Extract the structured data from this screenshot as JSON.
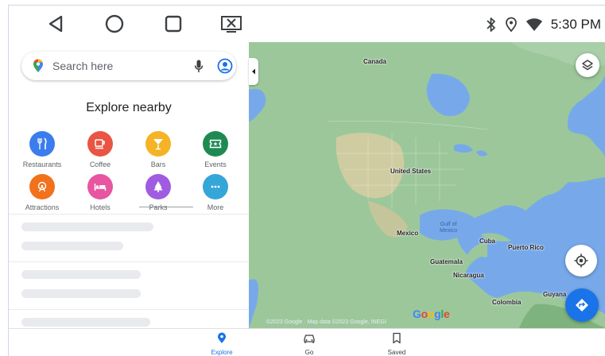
{
  "system_bar": {
    "time": "5:30 PM"
  },
  "search": {
    "placeholder": "Search here"
  },
  "explore": {
    "title": "Explore nearby",
    "categories": [
      {
        "label": "Restaurants",
        "icon": "fork-knife-icon",
        "color": "#3b7ded"
      },
      {
        "label": "Coffee",
        "icon": "coffee-cup-icon",
        "color": "#ea5443"
      },
      {
        "label": "Bars",
        "icon": "cocktail-glass-icon",
        "color": "#f5b325"
      },
      {
        "label": "Events",
        "icon": "ticket-icon",
        "color": "#1e8a52"
      },
      {
        "label": "Attractions",
        "icon": "ferris-wheel-icon",
        "color": "#f2711c"
      },
      {
        "label": "Hotels",
        "icon": "bed-icon",
        "color": "#e855a0"
      },
      {
        "label": "Parks",
        "icon": "tree-icon",
        "color": "#a05ce0"
      },
      {
        "label": "More",
        "icon": "more-dots-icon",
        "color": "#35a6d8"
      }
    ]
  },
  "map": {
    "labels": {
      "canada": "Canada",
      "united_states": "United States",
      "mexico": "Mexico",
      "gulf_line1": "Gulf of",
      "gulf_line2": "Mexico",
      "cuba": "Cuba",
      "puerto_rico": "Puerto Rico",
      "guatemala": "Guatemala",
      "nicaragua": "Nicaragua",
      "colombia": "Colombia",
      "guyana": "Guyana"
    },
    "attribution": "©2023 Google · Map data ©2023 Google, INEGI",
    "google_logo": "Google"
  },
  "bottom_nav": {
    "tabs": [
      {
        "label": "Explore",
        "icon": "location-pin-icon",
        "active": true
      },
      {
        "label": "Go",
        "icon": "car-icon",
        "active": false
      },
      {
        "label": "Saved",
        "icon": "bookmark-icon",
        "active": false
      }
    ]
  },
  "colors": {
    "accent": "#1a73e8",
    "ocean": "#77a9ea",
    "land": "#9cc79b"
  }
}
